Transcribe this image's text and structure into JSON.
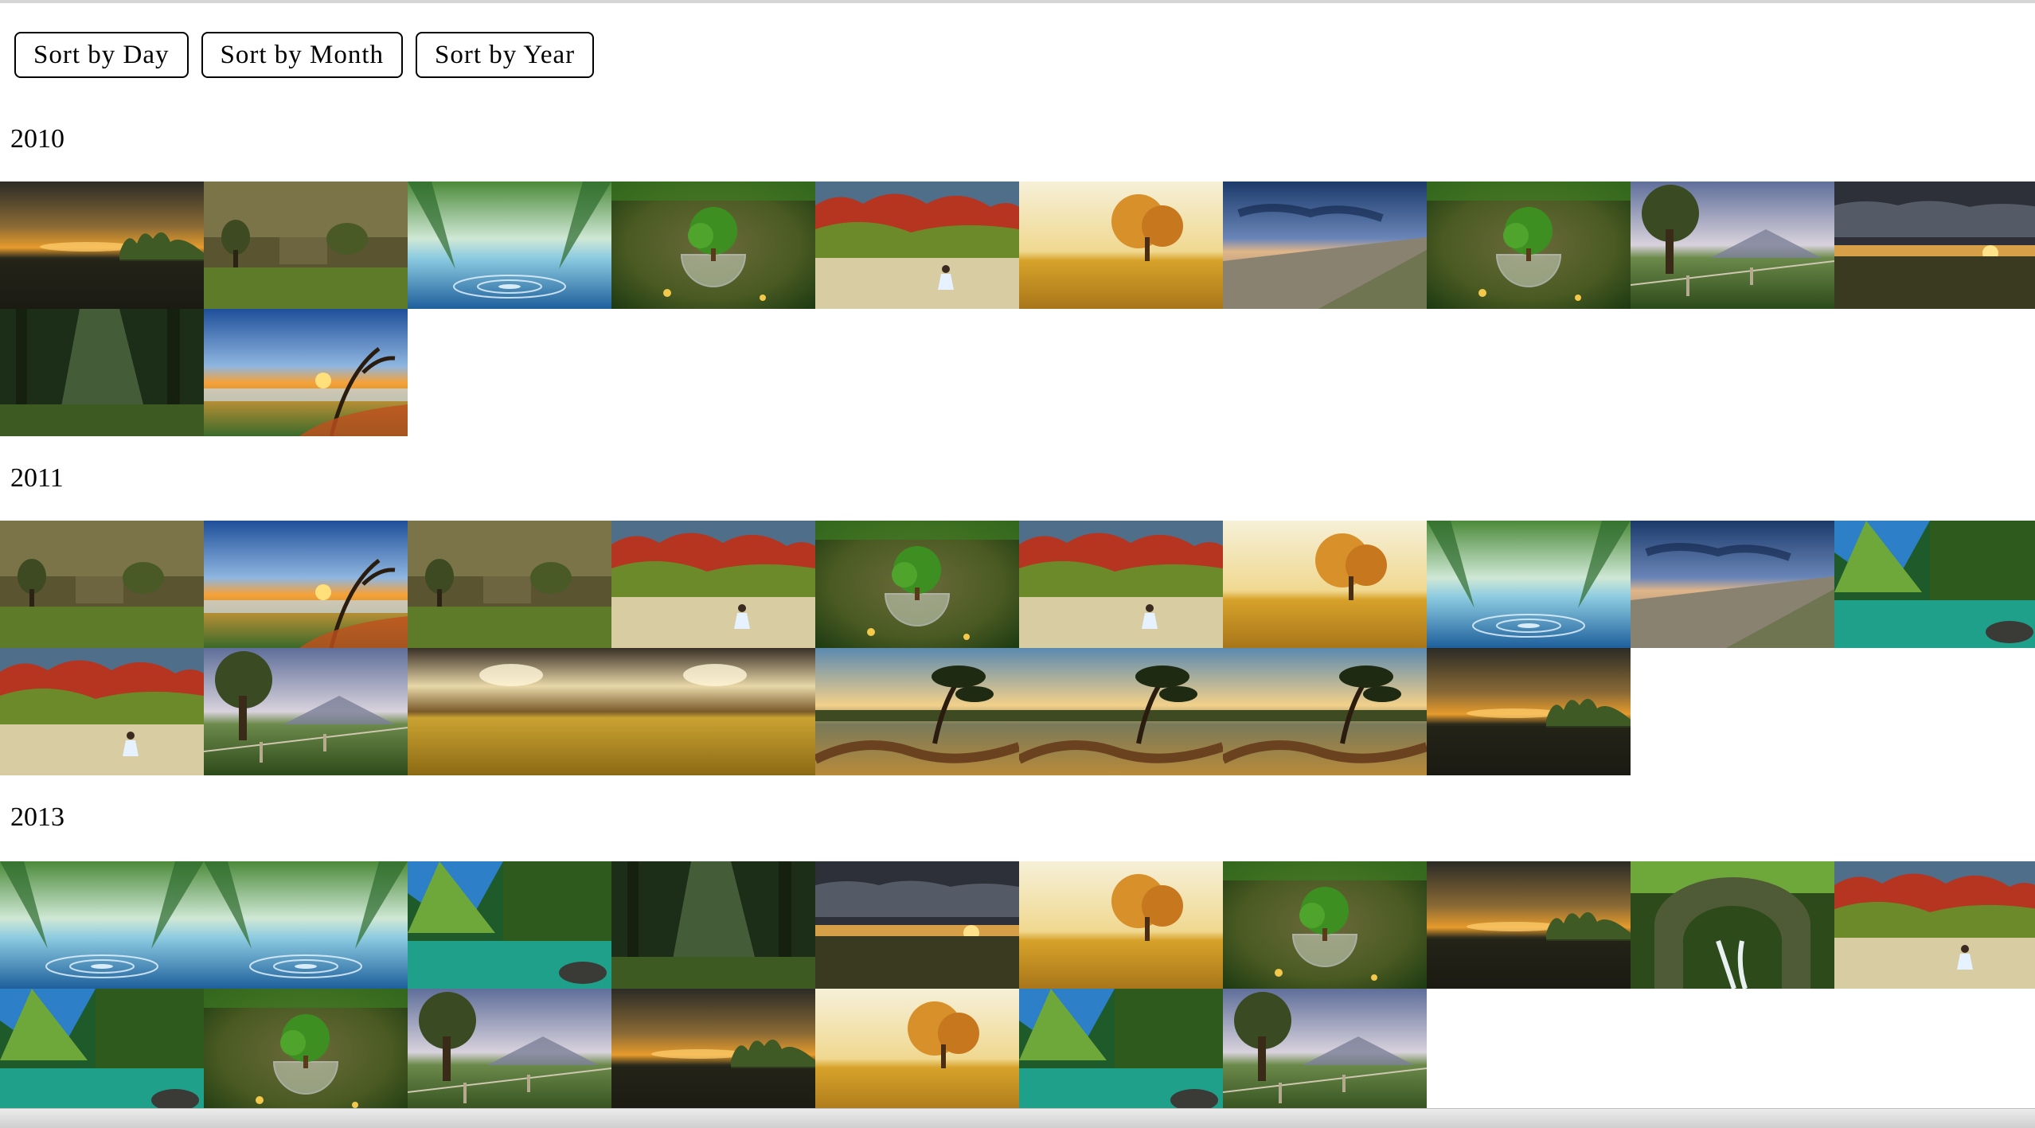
{
  "toolbar": {
    "sort_day_label": "Sort by Day",
    "sort_month_label": "Sort by Month",
    "sort_year_label": "Sort by Year"
  },
  "groups": [
    {
      "year": "2010",
      "photos": [
        "sunset-lake",
        "golden-ruins",
        "forest-ripple",
        "glass-tree",
        "autumn-girl",
        "golden-tree",
        "dusk-shore",
        "glass-tree",
        "fenced-pasture",
        "cloudy-sunset",
        "green-forest",
        "beach-sunset"
      ]
    },
    {
      "year": "2011",
      "photos": [
        "golden-ruins",
        "beach-sunset",
        "golden-ruins",
        "autumn-girl",
        "glass-tree",
        "autumn-girl",
        "golden-tree",
        "forest-ripple",
        "dusk-shore",
        "mountain-lake",
        "autumn-girl",
        "fenced-pasture",
        "wheat-storm",
        "wheat-storm",
        "pine-lake",
        "pine-lake",
        "pine-lake",
        "sunset-lake"
      ]
    },
    {
      "year": "2013",
      "photos": [
        "forest-ripple",
        "forest-ripple",
        "mountain-lake",
        "green-forest",
        "cloudy-sunset",
        "golden-tree",
        "glass-tree",
        "sunset-lake",
        "stone-bridge",
        "autumn-girl",
        "mountain-lake",
        "glass-tree",
        "fenced-pasture",
        "sunset-lake",
        "golden-tree",
        "mountain-lake",
        "fenced-pasture"
      ]
    }
  ]
}
